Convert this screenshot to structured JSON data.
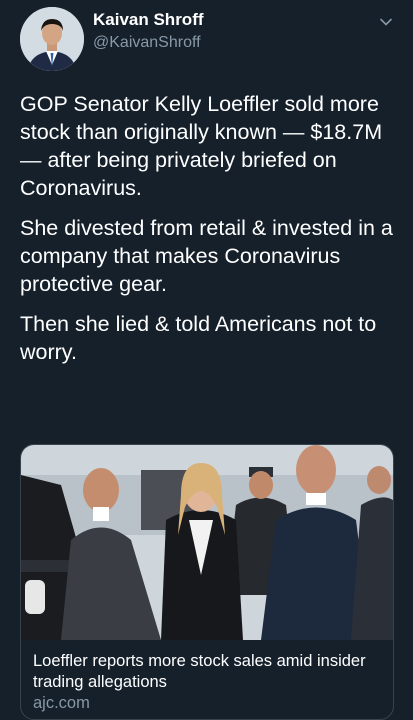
{
  "author": {
    "display_name": "Kaivan Shroff",
    "handle": "@KaivanShroff",
    "avatar_icon": "profile-photo"
  },
  "tweet": {
    "paragraphs": [
      "GOP Senator Kelly Loeffler sold more stock than originally known — $18.7M— after being privately briefed on Coronavirus.",
      "She divested from retail & invested in a company that makes Coronavirus protective gear.",
      "Then she lied & told Americans not to worry."
    ]
  },
  "link_card": {
    "title": "Loeffler reports more stock sales amid insider trading allegations",
    "domain": "ajc.com"
  },
  "theme": {
    "background": "#15202b",
    "text": "#ffffff",
    "secondary_text": "#8899a6",
    "border": "#38444d"
  }
}
